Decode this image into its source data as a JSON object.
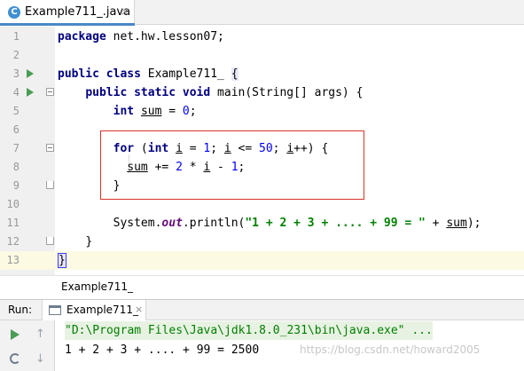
{
  "editor_tab": {
    "label": "Example711_.java",
    "close": "×",
    "icon_letter": "C"
  },
  "line_numbers": [
    "1",
    "2",
    "3",
    "4",
    "5",
    "6",
    "7",
    "8",
    "9",
    "10",
    "11",
    "12",
    "13"
  ],
  "code": {
    "l1": {
      "kw": "package",
      "rest": " net.hw.lesson07;"
    },
    "l3": {
      "kw1": "public",
      "kw2": "class",
      "name": " Example711_ ",
      "brace": "{"
    },
    "l4": {
      "kw1": "public",
      "kw2": "static",
      "kw3": "void",
      "rest": " main(String[] args) {"
    },
    "l5": {
      "kw": "int",
      "var": "sum",
      "op": " = ",
      "num": "0",
      "end": ";"
    },
    "l7": {
      "kw1": "for",
      "p1": " (",
      "kw2": "int",
      "sp": " ",
      "var1": "i",
      "p2": " = ",
      "n1": "1",
      "p3": "; ",
      "var2": "i",
      "p4": " <= ",
      "n2": "50",
      "p5": "; ",
      "var3": "i",
      "p6": "++) {"
    },
    "l8": {
      "var1": "sum",
      "p1": " += ",
      "n1": "2",
      "p2": " * ",
      "var2": "i",
      "p3": " - ",
      "n2": "1",
      "p4": ";"
    },
    "l9": {
      "brace": "}"
    },
    "l11": {
      "p1": "System.",
      "stat": "out",
      "p2": ".println(",
      "str": "\"1 + 2 + 3 + .... + 99 = \"",
      "p3": " + ",
      "var": "sum",
      "p4": ");"
    },
    "l12": {
      "brace": "}"
    },
    "l13": {
      "brace": "}"
    }
  },
  "breadcrumb": {
    "label": "Example711_"
  },
  "run_panel": {
    "title": "Run:",
    "tab_label": "Example711_",
    "tab_close": "×"
  },
  "console": {
    "command": "\"D:\\Program Files\\Java\\jdk1.8.0_231\\bin\\java.exe\" ...",
    "output": "1 + 2 + 3 + .... + 99 = 2500"
  },
  "watermark": "https://blog.csdn.net/howard2005",
  "colors": {
    "keyword": "#000080",
    "string": "#008000",
    "number": "#0000ff",
    "static_field": "#660e7a",
    "highlight_box": "#d9342b",
    "run_arrow": "#499c54",
    "caret_line": "#fcfae2"
  }
}
